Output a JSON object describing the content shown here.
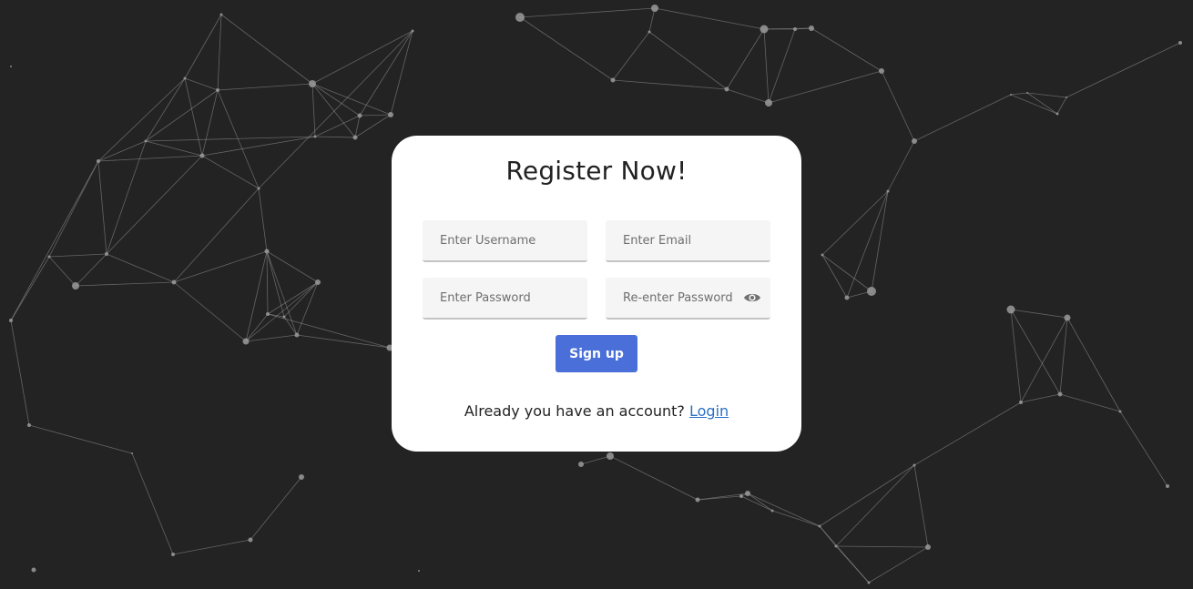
{
  "form": {
    "title": "Register Now!",
    "username_placeholder": "Enter Username",
    "email_placeholder": "Enter Email",
    "password_placeholder": "Enter Password",
    "repassword_placeholder": "Re-enter Password",
    "submit_label": "Sign up",
    "footer_text": "Already you have an account?",
    "login_link": "Login"
  },
  "icons": {
    "password_toggle": "eye-icon"
  },
  "colors": {
    "background": "#232323",
    "card": "#ffffff",
    "button": "#4a6fd8",
    "link": "#2a6fc8",
    "network": "#9a9a9a"
  }
}
